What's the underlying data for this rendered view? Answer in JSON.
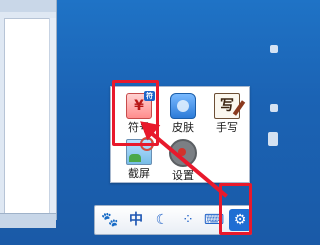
{
  "panel": {
    "tools": [
      {
        "label": "符号",
        "icon": "symbol-icon",
        "glyph": "¥"
      },
      {
        "label": "皮肤",
        "icon": "skin-icon"
      },
      {
        "label": "手写",
        "icon": "handwriting-icon",
        "glyph": "写"
      },
      {
        "label": "截屏",
        "icon": "screenshot-icon"
      },
      {
        "label": "设置",
        "icon": "settings-icon"
      }
    ]
  },
  "toolbar": {
    "items": [
      {
        "icon": "paw-icon",
        "glyph": "🐾"
      },
      {
        "icon": "chinese-mode",
        "glyph": "中"
      },
      {
        "icon": "moon-icon",
        "glyph": "☾"
      },
      {
        "icon": "dots-icon",
        "glyph": "⁘"
      },
      {
        "icon": "soft-keyboard-icon",
        "glyph": "⌨"
      },
      {
        "icon": "settings-gear-icon",
        "glyph": "⚙"
      }
    ]
  },
  "colors": {
    "desktop": "#1b63b4",
    "highlight": "#e8192c",
    "toolbar_accent": "#1f6ed3"
  }
}
